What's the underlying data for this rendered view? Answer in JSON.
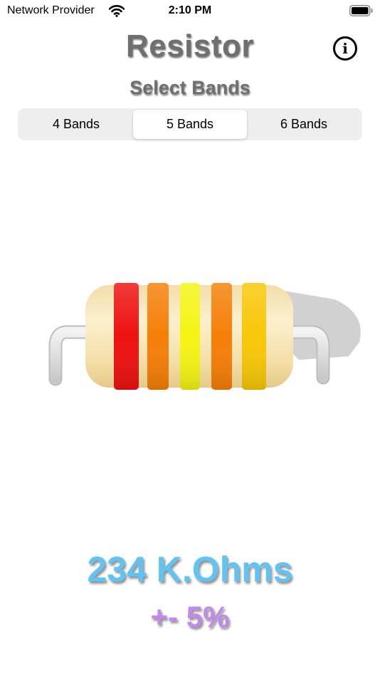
{
  "status_bar": {
    "carrier": "Network Provider",
    "time": "2:10 PM",
    "wifi_icon": "wifi-icon",
    "battery_icon": "battery-icon"
  },
  "header": {
    "title": "Resistor",
    "subtitle": "Select Bands",
    "info_icon": "info-icon",
    "info_glyph": "i"
  },
  "segments": [
    {
      "label": "4 Bands",
      "selected": false
    },
    {
      "label": "5 Bands",
      "selected": true
    },
    {
      "label": "6 Bands",
      "selected": false
    }
  ],
  "resistor": {
    "body_color": "#f6e2aa",
    "bands": [
      {
        "name": "band-1",
        "color": "#ee1111"
      },
      {
        "name": "band-2",
        "color": "#f57f07"
      },
      {
        "name": "band-3",
        "color": "#f4f414"
      },
      {
        "name": "band-4",
        "color": "#f57f07"
      },
      {
        "name": "band-5",
        "color": "#f7c708"
      }
    ]
  },
  "result": {
    "resistance": "234 K.Ohms",
    "tolerance": "+- 5%"
  },
  "colors": {
    "title": "#6f6f6f",
    "resistance": "#62c2f0",
    "tolerance": "#c388ec"
  }
}
